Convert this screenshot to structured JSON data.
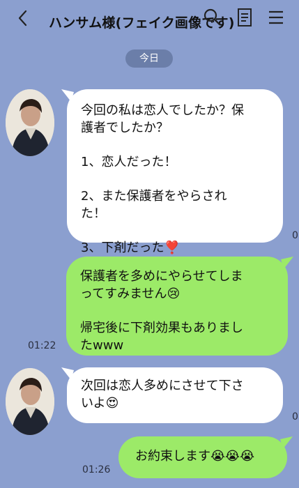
{
  "header": {
    "title": "ハンサム様(フェイク画像です)"
  },
  "date_divider": "今日",
  "messages": [
    {
      "direction": "incoming",
      "lines": [
        "今回の私は恋人でしたか？保",
        "護者でしたか？",
        "",
        "1、恋人だった！",
        "",
        "2、また保護者をやらされ",
        "た！",
        "",
        "3、下剤だった❣️"
      ],
      "edge_fragment": "0"
    },
    {
      "direction": "outgoing",
      "lines": [
        "保護者を多めにやらせてしま",
        "ってすみません😢",
        "",
        "帰宅後に下剤効果もありまし",
        "たwww"
      ],
      "time": "01:22"
    },
    {
      "direction": "incoming",
      "lines": [
        "次回は恋人多めにさせて下さ",
        "いよ😍"
      ],
      "edge_fragment": "0"
    },
    {
      "direction": "outgoing",
      "lines": [
        "お約束します😭😭😭"
      ],
      "time": "01:26"
    }
  ],
  "colors": {
    "background": "#8b9fcf",
    "incoming_bubble": "#ffffff",
    "outgoing_bubble": "#9cea68",
    "date_pill": "#6b7ea9"
  },
  "icons": [
    "chevron-left-icon",
    "search-icon",
    "notes-icon",
    "menu-icon"
  ]
}
